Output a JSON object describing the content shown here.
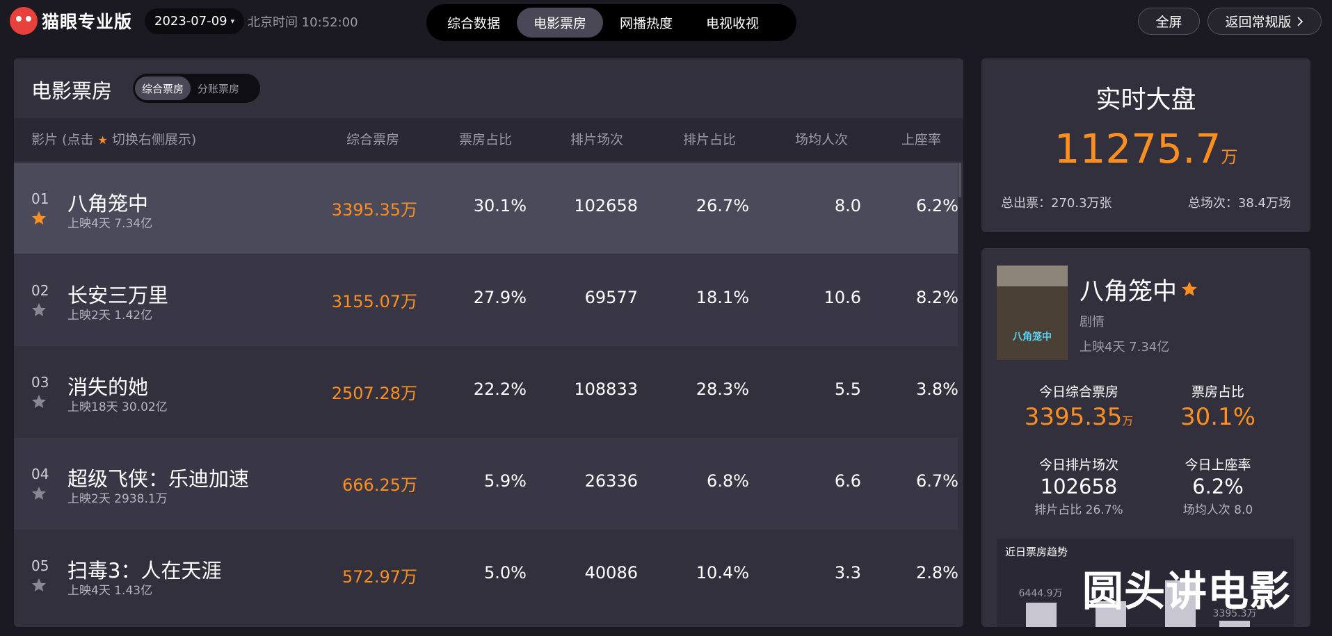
{
  "app": {
    "logo_text": "猫眼专业版",
    "date": "2023-07-09",
    "clock": "北京时间 10:52:00"
  },
  "tabs": [
    {
      "label": "综合数据",
      "active": false
    },
    {
      "label": "电影票房",
      "active": true
    },
    {
      "label": "网播热度",
      "active": false
    },
    {
      "label": "电视收视",
      "active": false
    }
  ],
  "buttons": {
    "fullscreen": "全屏",
    "back": "返回常规版"
  },
  "box_office": {
    "title": "电影票房",
    "sub_tabs": [
      {
        "label": "综合票房",
        "active": true
      },
      {
        "label": "分账票房",
        "active": false
      }
    ],
    "header": {
      "film_pre": "影片 (点击",
      "film_post": "切换右侧展示)",
      "box": "综合票房",
      "share": "票房占比",
      "screenings": "排片场次",
      "screening_share": "排片占比",
      "avg_attendance": "场均人次",
      "occupancy": "上座率"
    },
    "rows": [
      {
        "rank": "01",
        "name": "八角笼中",
        "meta": "上映4天  7.34亿",
        "box": "3395.35万",
        "share": "30.1%",
        "screenings": "102658",
        "screening_share": "26.7%",
        "avg": "8.0",
        "occupancy": "6.2%",
        "starred": true
      },
      {
        "rank": "02",
        "name": "长安三万里",
        "meta": "上映2天  1.42亿",
        "box": "3155.07万",
        "share": "27.9%",
        "screenings": "69577",
        "screening_share": "18.1%",
        "avg": "10.6",
        "occupancy": "8.2%",
        "starred": false
      },
      {
        "rank": "03",
        "name": "消失的她",
        "meta": "上映18天  30.02亿",
        "box": "2507.28万",
        "share": "22.2%",
        "screenings": "108833",
        "screening_share": "28.3%",
        "avg": "5.5",
        "occupancy": "3.8%",
        "starred": false
      },
      {
        "rank": "04",
        "name": "超级飞侠：乐迪加速",
        "meta": "上映2天  2938.1万",
        "box": "666.25万",
        "share": "5.9%",
        "screenings": "26336",
        "screening_share": "6.8%",
        "avg": "6.6",
        "occupancy": "6.7%",
        "starred": false
      },
      {
        "rank": "05",
        "name": "扫毒3：人在天涯",
        "meta": "上映4天  1.43亿",
        "box": "572.97万",
        "share": "5.0%",
        "screenings": "40086",
        "screening_share": "10.4%",
        "avg": "3.3",
        "occupancy": "2.8%",
        "starred": false
      }
    ]
  },
  "realtime": {
    "title": "实时大盘",
    "value": "11275.7",
    "unit": "万",
    "total_tickets": "总出票：270.3万张",
    "total_screenings": "总场次：38.4万场"
  },
  "detail": {
    "poster_title": "八角笼中",
    "name": "八角笼中",
    "genre": "剧情",
    "meta": "上映4天  7.34亿",
    "today_box_label": "今日综合票房",
    "today_box_value": "3395.35",
    "today_box_unit": "万",
    "share_label": "票房占比",
    "share_value": "30.1%",
    "screenings_label": "今日排片场次",
    "screenings_value": "102658",
    "screening_share_sub": "排片占比 26.7%",
    "occupancy_label": "今日上座率",
    "occupancy_value": "6.2%",
    "avg_sub": "场均人次 8.0",
    "trend_title": "近日票房趋势",
    "trend_labels": [
      "6444.9万",
      "3395.3万"
    ]
  },
  "watermark": "圆头讲电影",
  "colors": {
    "accent": "#ff8f1f",
    "panel": "#32303d",
    "background": "#1b1a22"
  }
}
